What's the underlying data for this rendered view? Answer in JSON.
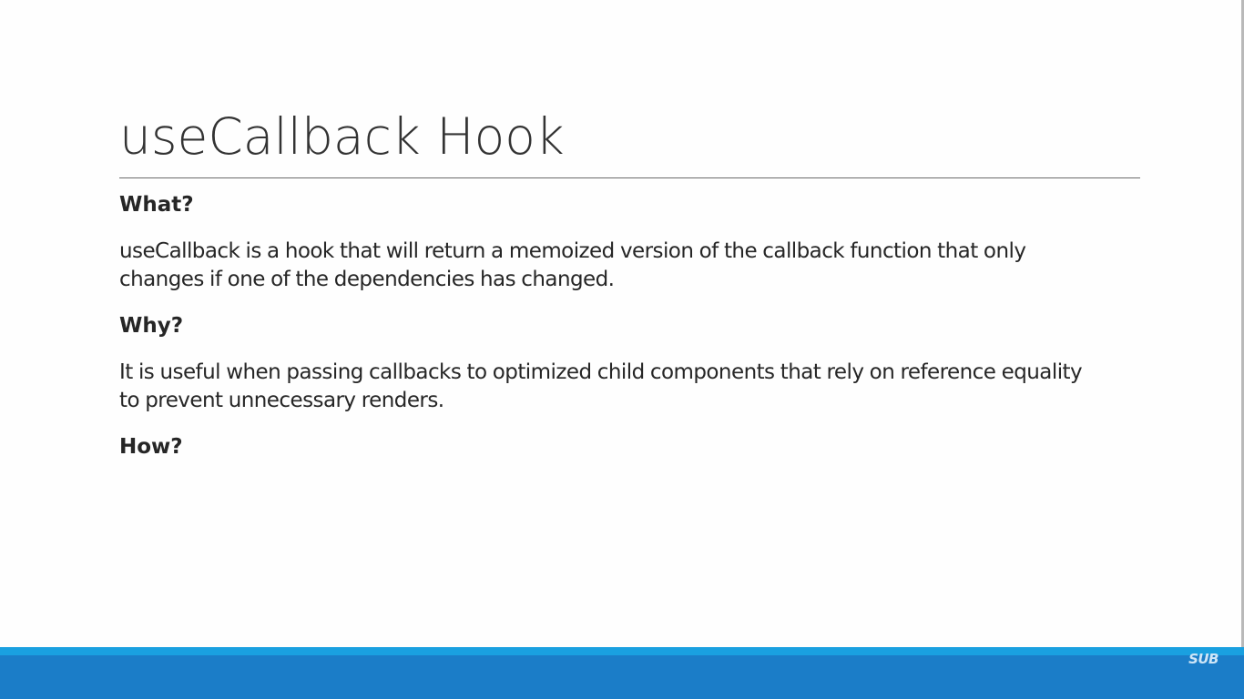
{
  "slide": {
    "title": "useCallback Hook",
    "sections": [
      {
        "heading": "What?",
        "lines": [
          "useCallback is a hook that will return a memoized version of the callback function that only",
          "changes if one of the dependencies has changed."
        ]
      },
      {
        "heading": "Why?",
        "lines": [
          "It is useful when passing callbacks to optimized child components that rely on reference equality",
          "to prevent unnecessary renders."
        ]
      },
      {
        "heading": "How?",
        "lines": []
      }
    ],
    "watermark": "SUB"
  },
  "colors": {
    "background": "#fefefe",
    "text": "#262626",
    "title": "#333333",
    "bar_light": "#1aa0e0",
    "bar_dark": "#1b7dc8"
  }
}
